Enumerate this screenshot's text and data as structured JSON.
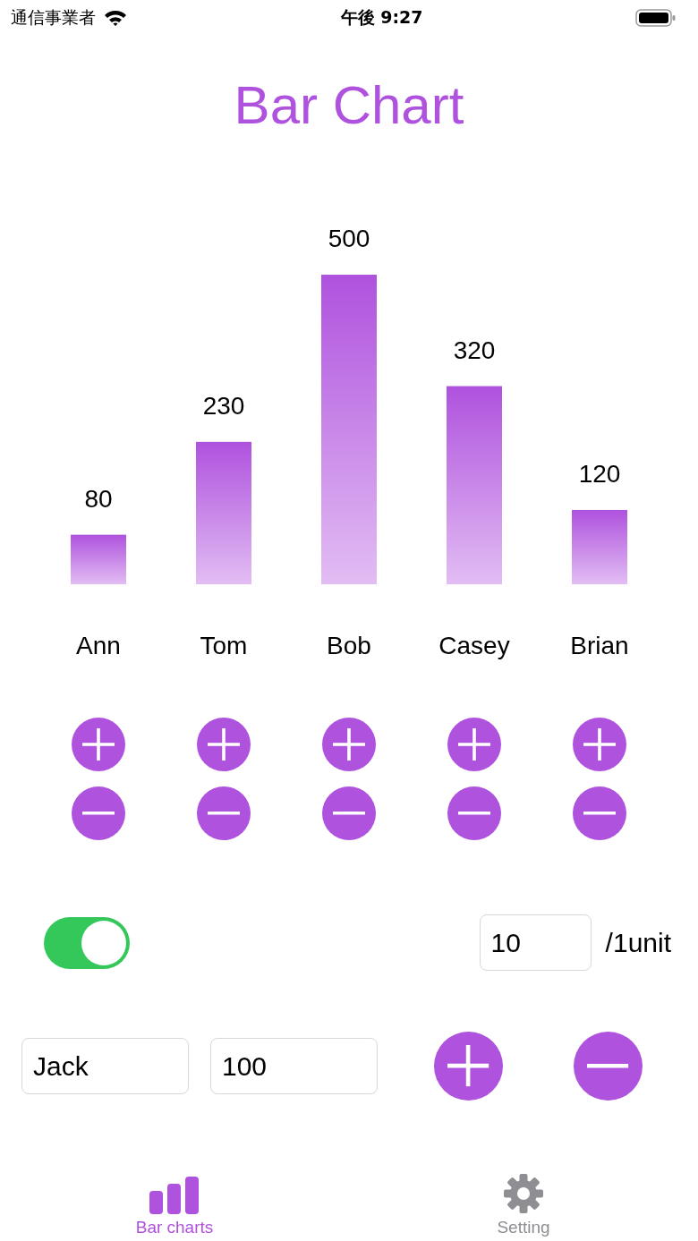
{
  "status_bar": {
    "carrier": "通信事業者",
    "time": "午後 9:27"
  },
  "title": "Bar Chart",
  "chart_data": {
    "type": "bar",
    "categories": [
      "Ann",
      "Tom",
      "Bob",
      "Casey",
      "Brian"
    ],
    "values": [
      80,
      230,
      500,
      320,
      120
    ],
    "data_labels": true
  },
  "toggle": {
    "on": true
  },
  "unit_field": {
    "value": "10"
  },
  "unit_label": "/1unit",
  "name_field": {
    "value": "Jack"
  },
  "value_field": {
    "value": "100"
  },
  "tabs": [
    {
      "label": "Bar charts",
      "selected": true
    },
    {
      "label": "Setting",
      "selected": false
    }
  ]
}
